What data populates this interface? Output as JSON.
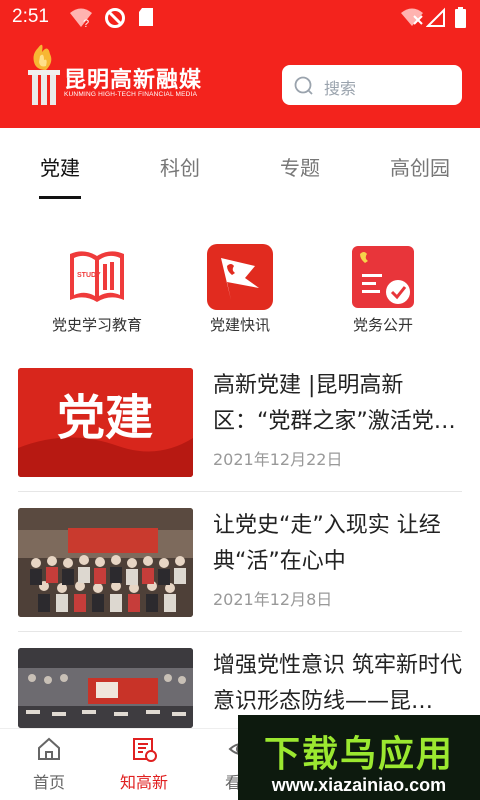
{
  "status_bar": {
    "time": "2:51",
    "icons": [
      "wifi-question-icon",
      "no-disturb-icon",
      "sd-card-icon",
      "wifi-off-icon",
      "signal-icon",
      "battery-icon"
    ]
  },
  "header": {
    "logo_name": "昆明高新融媒",
    "logo_sub": "KUNMING HIGH-TECH FINANCIAL MEDIA",
    "search_placeholder": "搜索",
    "brand_color": "#f3231d"
  },
  "tabs": [
    {
      "label": "党建",
      "active": true
    },
    {
      "label": "科创",
      "active": false
    },
    {
      "label": "专题",
      "active": false
    },
    {
      "label": "高创园",
      "active": false
    }
  ],
  "shortcuts": [
    {
      "label": "党史学习教育",
      "icon": "book-study-icon"
    },
    {
      "label": "党建快讯",
      "icon": "party-flag-icon"
    },
    {
      "label": "党务公开",
      "icon": "document-check-icon"
    }
  ],
  "news": [
    {
      "title": "高新党建 |昆明高新区：“党群之家”激活党…",
      "date": "2021年12月22日",
      "thumb_text": "党建"
    },
    {
      "title": "让党史“走”入现实 让经典“活”在心中",
      "date": "2021年12月8日",
      "thumb_text": ""
    },
    {
      "title": "增强党性意识 筑牢新时代意识形态防线——昆…",
      "date": "",
      "thumb_text": ""
    }
  ],
  "bottom_nav": [
    {
      "label": "首页",
      "icon": "home-icon",
      "active": false
    },
    {
      "label": "知高新",
      "icon": "news-icon",
      "active": true
    },
    {
      "label": "看高",
      "icon": "eye-icon",
      "active": false
    }
  ],
  "watermark": {
    "big": "下载乌应用",
    "small": "www.xiazainiao.com"
  }
}
